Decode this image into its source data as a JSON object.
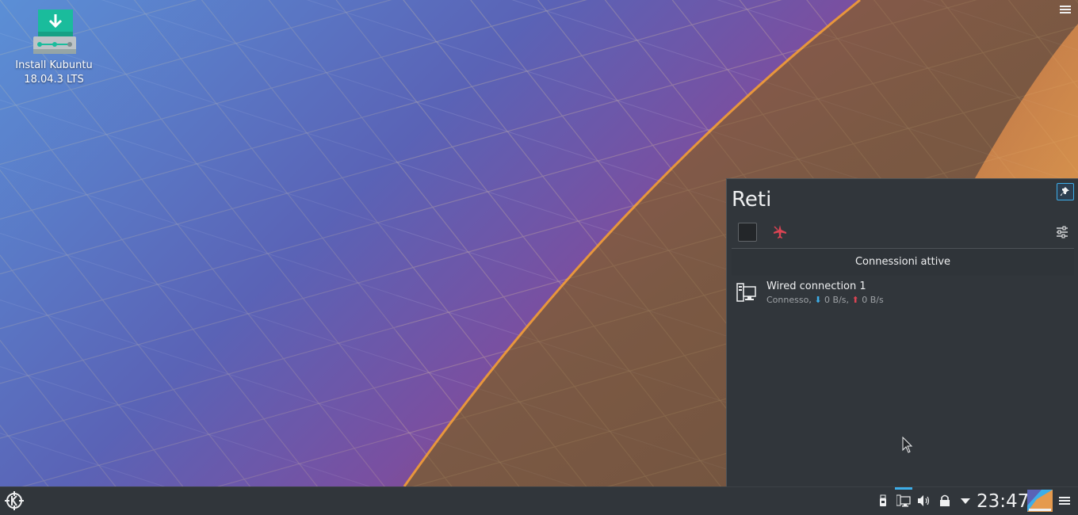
{
  "desktop": {
    "icon_label_line1": "Install Kubuntu",
    "icon_label_line2": "18.04.3 LTS",
    "menu_icon": "hamburger-menu-icon"
  },
  "network_popup": {
    "title": "Reti",
    "pin_icon": "pin-icon",
    "wifi_enabled": false,
    "airplane_icon": "airplane-mode-icon",
    "config_icon": "configure-icon",
    "section_header": "Connessioni attive",
    "connections": [
      {
        "name": "Wired connection 1",
        "status": "Connesso,",
        "download_arrow": "⬇",
        "download": "0 B/s,",
        "upload_arrow": "⬆",
        "upload": "0 B/s",
        "icon": "wired-network-icon"
      }
    ]
  },
  "taskbar": {
    "launcher_icon": "kde-logo-icon",
    "tray": [
      "usb-icon",
      "network-wired-icon",
      "volume-icon",
      "lock-icon",
      "expand-tray-icon"
    ],
    "clock": "23:47",
    "accent": "#3daee9"
  }
}
